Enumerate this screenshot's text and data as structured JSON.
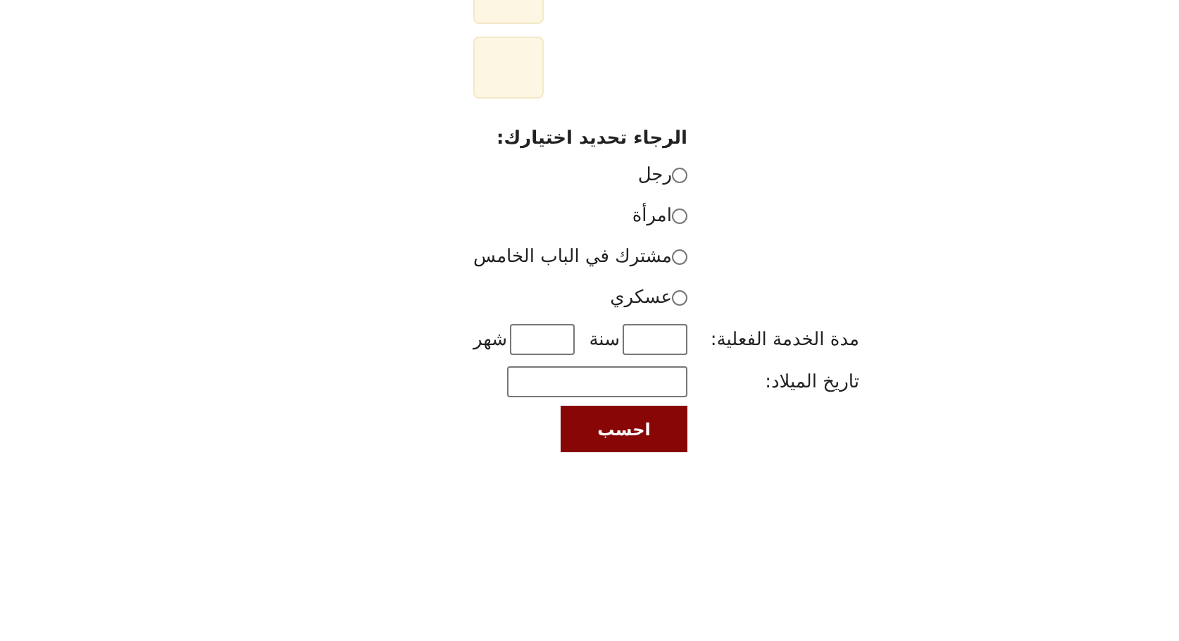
{
  "heading": "الرجاء تحديد اختيارك:",
  "options": [
    {
      "label": "رجل",
      "selected": false
    },
    {
      "label": "امرأة",
      "selected": false
    },
    {
      "label": "مشترك في الباب الخامس",
      "selected": false
    },
    {
      "label": "عسكري",
      "selected": false
    }
  ],
  "service": {
    "label": "مدة الخدمة الفعلية:",
    "fields": [
      {
        "unit": "سنة"
      },
      {
        "unit": "شهر"
      }
    ]
  },
  "birth_date": {
    "label": "تاريخ الميلاد:"
  },
  "button": "احسب"
}
